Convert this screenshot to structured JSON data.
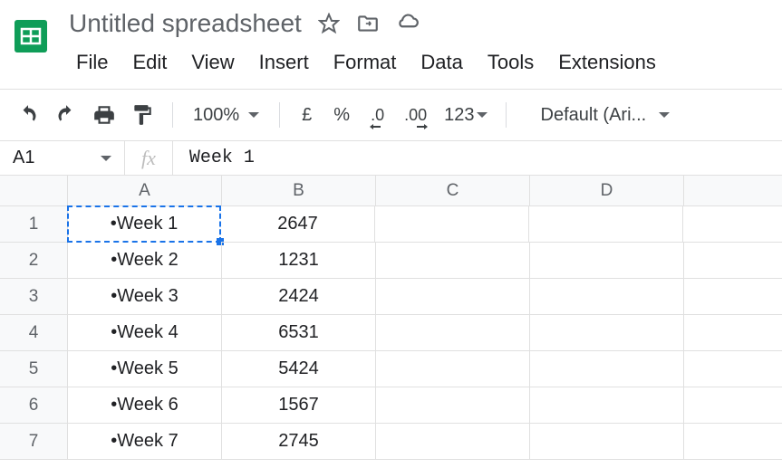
{
  "header": {
    "title": "Untitled spreadsheet",
    "menu": [
      "File",
      "Edit",
      "View",
      "Insert",
      "Format",
      "Data",
      "Tools",
      "Extensions"
    ]
  },
  "toolbar": {
    "zoom": "100%",
    "currency": "£",
    "percent": "%",
    "dec_decrease": ".0",
    "dec_increase": ".00",
    "num_format": "123",
    "font": "Default (Ari..."
  },
  "name_box": "A1",
  "formula_bar_value": "Week 1",
  "columns": [
    "A",
    "B",
    "C",
    "D"
  ],
  "rows": [
    {
      "n": "1",
      "a": "•Week 1",
      "b": "2647"
    },
    {
      "n": "2",
      "a": "•Week 2",
      "b": "1231"
    },
    {
      "n": "3",
      "a": "•Week 3",
      "b": "2424"
    },
    {
      "n": "4",
      "a": "•Week 4",
      "b": "6531"
    },
    {
      "n": "5",
      "a": "•Week 5",
      "b": "5424"
    },
    {
      "n": "6",
      "a": "•Week 6",
      "b": "1567"
    },
    {
      "n": "7",
      "a": "•Week 7",
      "b": "2745"
    }
  ],
  "selected_cell": "A1"
}
